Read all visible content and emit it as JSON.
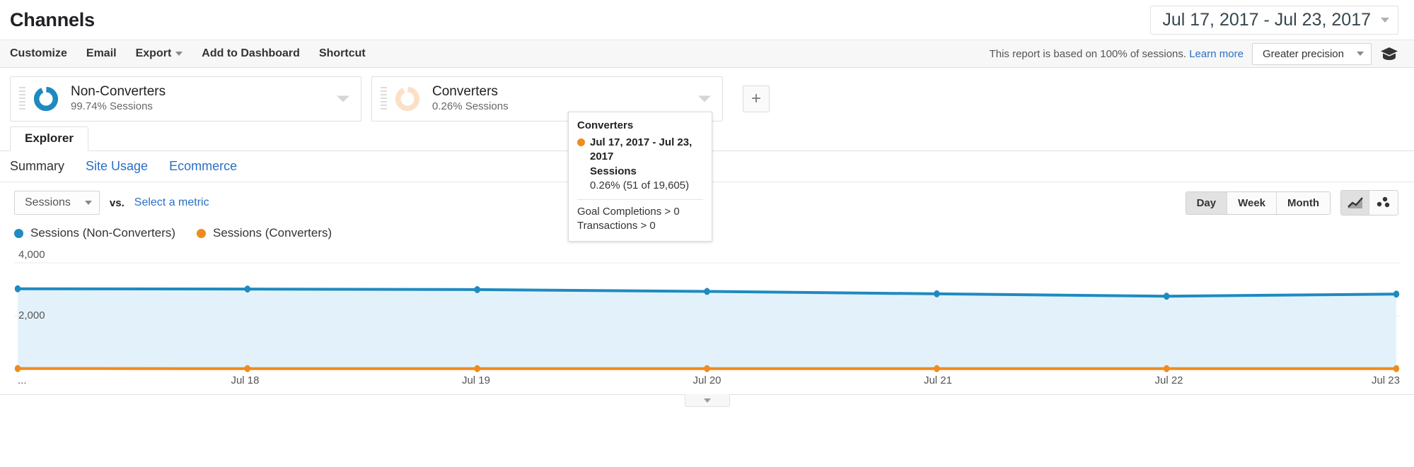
{
  "header": {
    "title": "Channels",
    "date_range": "Jul 17, 2017 - Jul 23, 2017"
  },
  "toolbar": {
    "items": [
      {
        "label": "Customize",
        "caret": false
      },
      {
        "label": "Email",
        "caret": false
      },
      {
        "label": "Export",
        "caret": true
      },
      {
        "label": "Add to Dashboard",
        "caret": false
      },
      {
        "label": "Shortcut",
        "caret": false
      }
    ],
    "sampling_note": "This report is based on 100% of sessions.",
    "learn_more": "Learn more",
    "precision_label": "Greater precision"
  },
  "segments": [
    {
      "name": "Non-Converters",
      "sub": "99.74% Sessions",
      "color": "#1f8ac0",
      "percent": 99.74,
      "faded": false
    },
    {
      "name": "Converters",
      "sub": "0.26% Sessions",
      "color": "#f9dcc0",
      "percent": 0.26,
      "faded": true
    }
  ],
  "add_segment_label": "+",
  "tabs": {
    "main": [
      {
        "label": "Explorer",
        "active": true
      }
    ],
    "sub": [
      {
        "label": "Summary",
        "active": true
      },
      {
        "label": "Site Usage",
        "active": false
      },
      {
        "label": "Ecommerce",
        "active": false
      }
    ]
  },
  "metric_row": {
    "primary_metric": "Sessions",
    "vs_label": "vs.",
    "select_metric_label": "Select a metric",
    "granularity": [
      {
        "label": "Day",
        "active": true
      },
      {
        "label": "Week",
        "active": false
      },
      {
        "label": "Month",
        "active": false
      }
    ],
    "chart_type_icons": [
      {
        "name": "line-chart-icon",
        "active": true
      },
      {
        "name": "scatter-plot-icon",
        "active": false
      }
    ]
  },
  "legend": [
    {
      "label": "Sessions (Non-Converters)",
      "color": "#1f8ac0"
    },
    {
      "label": "Sessions (Converters)",
      "color": "#ef8b20"
    }
  ],
  "tooltip": {
    "title": "Converters",
    "date_range": "Jul 17, 2017 - Jul 23, 2017",
    "metric": "Sessions",
    "value": "0.26% (51 of 19,605)",
    "dot_color": "#ef8b20",
    "conditions": [
      "Goal Completions > 0",
      "Transactions > 0"
    ]
  },
  "bottom": {
    "collapse_handle": "collapse-caret-icon"
  },
  "chart_data": {
    "type": "line",
    "title": "",
    "xlabel": "",
    "ylabel": "",
    "ylim": [
      0,
      4000
    ],
    "yticks": [
      2000,
      4000
    ],
    "ytick_labels": [
      "2,000",
      "4,000"
    ],
    "grid": true,
    "legend_position": "top-left",
    "x": [
      "...",
      "Jul 18",
      "Jul 19",
      "Jul 20",
      "Jul 21",
      "Jul 22",
      "Jul 23"
    ],
    "series": [
      {
        "name": "Sessions (Non-Converters)",
        "color": "#1f8ac0",
        "fill": "#e3f2fa",
        "values": [
          3020,
          3010,
          2990,
          2920,
          2830,
          2740,
          2820
        ]
      },
      {
        "name": "Sessions (Converters)",
        "color": "#ef8b20",
        "fill": "none",
        "values": [
          9,
          8,
          7,
          8,
          7,
          6,
          8
        ]
      }
    ]
  }
}
